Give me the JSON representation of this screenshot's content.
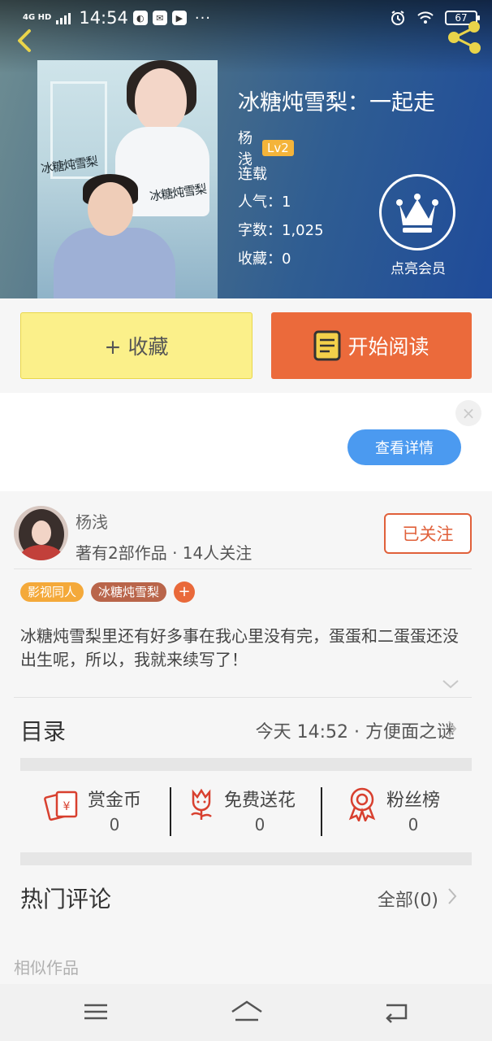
{
  "status_bar": {
    "network": "4G HD",
    "time": "14:54",
    "battery": "67"
  },
  "book": {
    "title": "冰糖炖雪梨：一起走",
    "author": "杨浅",
    "level": "Lv2",
    "status": "连载",
    "popularity": "人气：1",
    "word_count": "字数：1,025",
    "favorites": "收藏：0",
    "cover_text_1": "冰糖炖雪梨",
    "cover_text_2": "冰糖炖雪梨"
  },
  "vip": {
    "label": "点亮会员"
  },
  "actions": {
    "favorite_label": "+ 收藏",
    "read_label": "开始阅读"
  },
  "ad": {
    "close_label": "×",
    "detail_label": "查看详情"
  },
  "author_card": {
    "name": "杨浅",
    "works_info": "著有2部作品 · 14人关注",
    "follow_label": "已关注"
  },
  "tags": [
    {
      "label": "影视同人",
      "color": "#f4a93a"
    },
    {
      "label": "冰糖炖雪梨",
      "color": "#b9654a"
    }
  ],
  "tag_add": "+",
  "intro": "冰糖炖雪梨里还有好多事在我心里没有完，蛋蛋和二蛋蛋还没出生呢，所以，我就来续写了！",
  "toc": {
    "label": "目录",
    "latest": "今天 14:52 · 方便面之谜"
  },
  "stats": [
    {
      "label": "赏金币",
      "value": "0",
      "icon": "red-envelope-icon"
    },
    {
      "label": "免费送花",
      "value": "0",
      "icon": "flower-icon"
    },
    {
      "label": "粉丝榜",
      "value": "0",
      "icon": "medal-icon"
    }
  ],
  "comments": {
    "label": "热门评论",
    "all_label": "全部(0)"
  },
  "similar_label": "相似作品",
  "colors": {
    "accent_orange": "#eb6a3b",
    "favorite_yellow": "#fbf08a",
    "detail_blue": "#4b9af0",
    "icon_red": "#d8402f"
  }
}
